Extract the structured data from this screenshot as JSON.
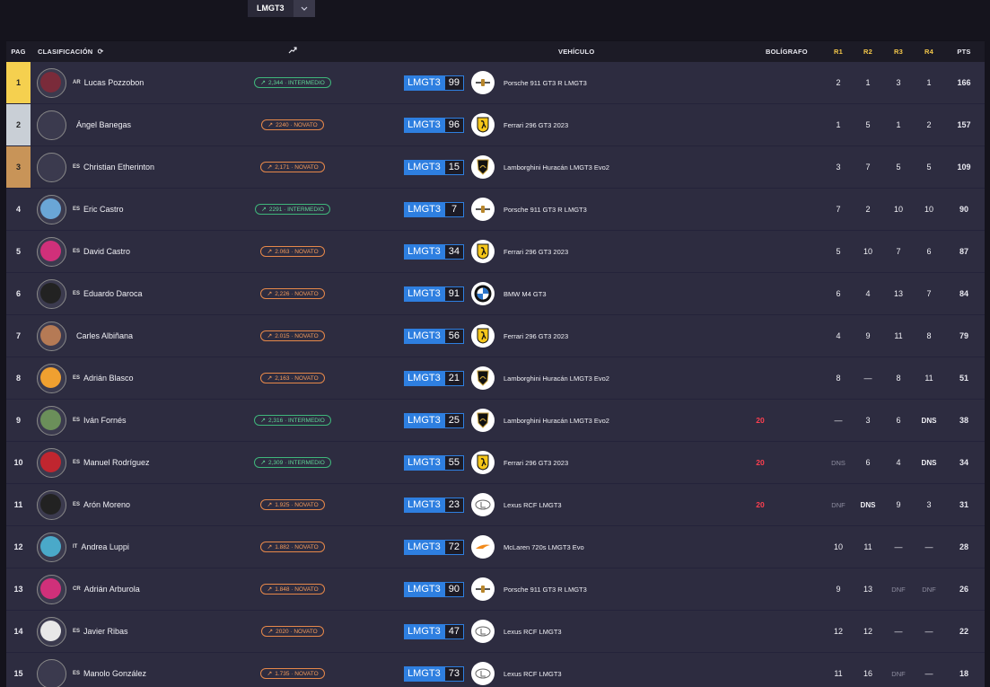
{
  "filter": {
    "selected_class": "LMGT3"
  },
  "headers": {
    "pag": "PAG",
    "clasificacion": "CLASIFICACIÓN",
    "vehiculo": "VEHÍCULO",
    "boligrafo": "BOLÍGRAFO",
    "r1": "R1",
    "r2": "R2",
    "r3": "R3",
    "r4": "R4",
    "pts": "PTS"
  },
  "colors": {
    "accent_class": "#2e7fe0",
    "first": "#f5d04f",
    "second": "#c9cfd6",
    "third": "#c89458",
    "penalty": "#ff3f4f"
  },
  "rows": [
    {
      "pos": "1",
      "cc": "AR",
      "name": "Lucas Pozzobon",
      "rating": "2,344 · INTERMEDIO",
      "rclass": "green",
      "cls": "LMGT3",
      "num": "99",
      "brand": "porsche",
      "car": "Porsche 911 GT3 R LMGT3",
      "pen": "",
      "r1": "2",
      "r2": "1",
      "r3": "3",
      "r4": "1",
      "pts": "166",
      "av": "#7a2b3a"
    },
    {
      "pos": "2",
      "cc": "",
      "name": "Ángel Banegas",
      "rating": "2240 · NOVATO",
      "rclass": "orange",
      "cls": "LMGT3",
      "num": "96",
      "brand": "ferrari",
      "car": "Ferrari 296 GT3 2023",
      "pen": "",
      "r1": "1",
      "r2": "5",
      "r3": "1",
      "r4": "2",
      "pts": "157",
      "av": "#3b3a4e"
    },
    {
      "pos": "3",
      "cc": "ES",
      "name": "Christian Etherinton",
      "rating": "2,171 · NOVATO",
      "rclass": "orange",
      "cls": "LMGT3",
      "num": "15",
      "brand": "lamborghini",
      "car": "Lamborghini Huracán LMGT3 Evo2",
      "pen": "",
      "r1": "3",
      "r2": "7",
      "r3": "5",
      "r4": "5",
      "pts": "109",
      "av": "#3b3a4e"
    },
    {
      "pos": "4",
      "cc": "ES",
      "name": "Eric Castro",
      "rating": "2291 · INTERMEDIO",
      "rclass": "green",
      "cls": "LMGT3",
      "num": "7",
      "brand": "porsche",
      "car": "Porsche 911 GT3 R LMGT3",
      "pen": "",
      "r1": "7",
      "r2": "2",
      "r3": "10",
      "r4": "10",
      "pts": "90",
      "av": "#6aa6d6"
    },
    {
      "pos": "5",
      "cc": "ES",
      "name": "David Castro",
      "rating": "2.063 · NOVATO",
      "rclass": "orange",
      "cls": "LMGT3",
      "num": "34",
      "brand": "ferrari",
      "car": "Ferrari 296 GT3 2023",
      "pen": "",
      "r1": "5",
      "r2": "10",
      "r3": "7",
      "r4": "6",
      "pts": "87",
      "av": "#d0307a"
    },
    {
      "pos": "6",
      "cc": "ES",
      "name": "Eduardo Daroca",
      "rating": "2,226 · NOVATO",
      "rclass": "orange",
      "cls": "LMGT3",
      "num": "91",
      "brand": "bmw",
      "car": "BMW M4 GT3",
      "pen": "",
      "r1": "6",
      "r2": "4",
      "r3": "13",
      "r4": "7",
      "pts": "84",
      "av": "#222"
    },
    {
      "pos": "7",
      "cc": "",
      "name": "Carles Albiñana",
      "rating": "2.015 · NOVATO",
      "rclass": "orange",
      "cls": "LMGT3",
      "num": "56",
      "brand": "ferrari",
      "car": "Ferrari 296 GT3 2023",
      "pen": "",
      "r1": "4",
      "r2": "9",
      "r3": "11",
      "r4": "8",
      "pts": "79",
      "av": "#b57a55"
    },
    {
      "pos": "8",
      "cc": "ES",
      "name": "Adrián Blasco",
      "rating": "2,163 · NOVATO",
      "rclass": "orange",
      "cls": "LMGT3",
      "num": "21",
      "brand": "lamborghini",
      "car": "Lamborghini Huracán LMGT3 Evo2",
      "pen": "",
      "r1": "8",
      "r2": "—",
      "r3": "8",
      "r4": "11",
      "pts": "51",
      "av": "#f0a030"
    },
    {
      "pos": "9",
      "cc": "ES",
      "name": "Iván Fornés",
      "rating": "2,316 · INTERMEDIO",
      "rclass": "green",
      "cls": "LMGT3",
      "num": "25",
      "brand": "lamborghini",
      "car": "Lamborghini Huracán LMGT3 Evo2",
      "pen": "20",
      "r1": "—",
      "r2": "3",
      "r3": "6",
      "r4": "DNS",
      "pts": "38",
      "av": "#6b8f5a"
    },
    {
      "pos": "10",
      "cc": "ES",
      "name": "Manuel Rodríguez",
      "rating": "2,309 · INTERMEDIO",
      "rclass": "green",
      "cls": "LMGT3",
      "num": "55",
      "brand": "ferrari",
      "car": "Ferrari 296 GT3 2023",
      "pen": "20",
      "r1": "DNS",
      "r2": "6",
      "r3": "4",
      "r4": "DNS",
      "pts": "34",
      "av": "#c0262f"
    },
    {
      "pos": "11",
      "cc": "ES",
      "name": "Arón Moreno",
      "rating": "1.925 · NOVATO",
      "rclass": "orange",
      "cls": "LMGT3",
      "num": "23",
      "brand": "lexus",
      "car": "Lexus RCF LMGT3",
      "pen": "20",
      "r1": "DNF",
      "r2": "DNS",
      "r3": "9",
      "r4": "3",
      "pts": "31",
      "av": "#222"
    },
    {
      "pos": "12",
      "cc": "IT",
      "name": "Andrea Luppi",
      "rating": "1.882 · NOVATO",
      "rclass": "orange",
      "cls": "LMGT3",
      "num": "72",
      "brand": "mclaren",
      "car": "McLaren 720s LMGT3 Evo",
      "pen": "",
      "r1": "10",
      "r2": "11",
      "r3": "—",
      "r4": "—",
      "pts": "28",
      "av": "#4aa9c9"
    },
    {
      "pos": "13",
      "cc": "CR",
      "name": "Adrián Arburola",
      "rating": "1.848 · NOVATO",
      "rclass": "orange",
      "cls": "LMGT3",
      "num": "90",
      "brand": "porsche",
      "car": "Porsche 911 GT3 R LMGT3",
      "pen": "",
      "r1": "9",
      "r2": "13",
      "r3": "DNF",
      "r4": "DNF",
      "pts": "26",
      "av": "#d0307a"
    },
    {
      "pos": "14",
      "cc": "ES",
      "name": "Javier Ribas",
      "rating": "2020 · NOVATO",
      "rclass": "orange",
      "cls": "LMGT3",
      "num": "47",
      "brand": "lexus",
      "car": "Lexus RCF LMGT3",
      "pen": "",
      "r1": "12",
      "r2": "12",
      "r3": "—",
      "r4": "—",
      "pts": "22",
      "av": "#e8e8e8"
    },
    {
      "pos": "15",
      "cc": "ES",
      "name": "Manolo González",
      "rating": "1.735 · NOVATO",
      "rclass": "orange",
      "cls": "LMGT3",
      "num": "73",
      "brand": "lexus",
      "car": "Lexus RCF LMGT3",
      "pen": "",
      "r1": "11",
      "r2": "16",
      "r3": "DNF",
      "r4": "—",
      "pts": "18",
      "av": "#3b3a4e"
    }
  ]
}
